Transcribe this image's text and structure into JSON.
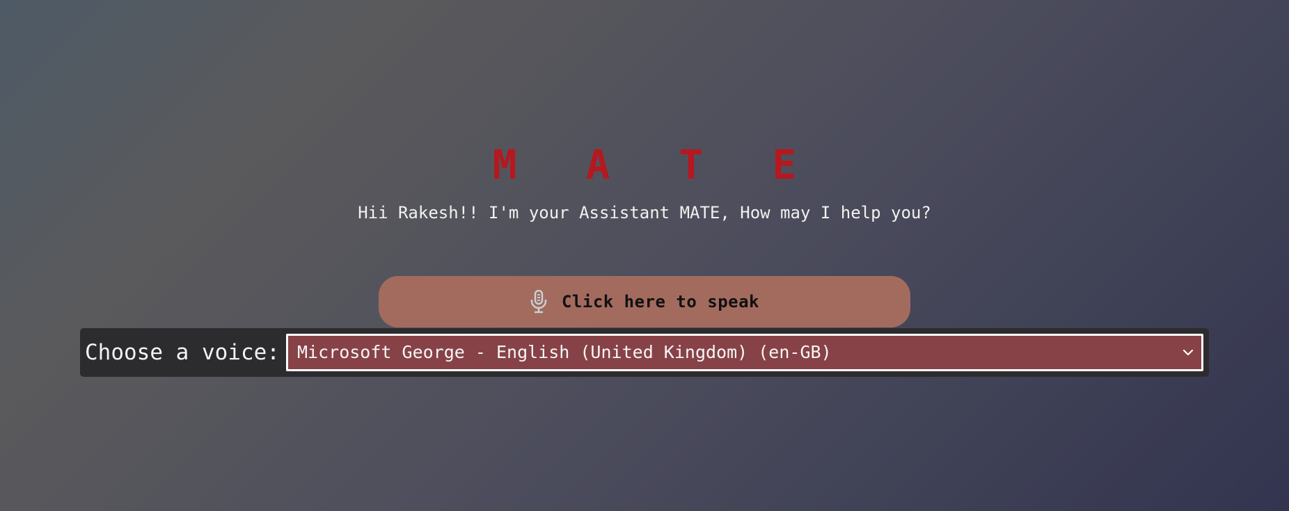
{
  "app": {
    "title": "M A T E",
    "greeting": "Hii Rakesh!! I'm your Assistant MATE, How may I help you?"
  },
  "speak": {
    "icon": "microphone-icon",
    "label": "Click here to speak"
  },
  "voice": {
    "label": "Choose a voice:",
    "selected": "Microsoft George - English (United Kingdom) (en-GB)",
    "icon": "chevron-down-icon"
  },
  "colors": {
    "title": "#b5181f",
    "speak_button": "#a36b5e",
    "select_bg": "#874247",
    "voice_bar_bg": "#2c2c2e"
  }
}
